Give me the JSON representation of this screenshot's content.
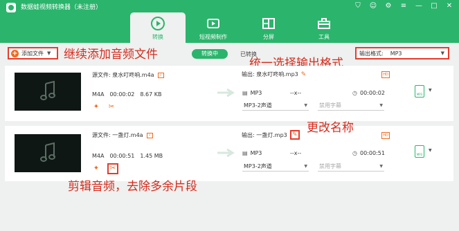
{
  "app": {
    "title": "数据蛙视频转换器（未注册）",
    "window_controls": [
      "cart-icon",
      "user-icon",
      "settings-icon",
      "menu-icon",
      "minimize-icon",
      "maximize-icon",
      "close-icon"
    ]
  },
  "tabs": [
    {
      "label": "转换",
      "icon": "convert-icon",
      "active": true
    },
    {
      "label": "短视频制作",
      "icon": "video-make-icon",
      "active": false
    },
    {
      "label": "分屏",
      "icon": "split-screen-icon",
      "active": false
    },
    {
      "label": "工具",
      "icon": "toolbox-icon",
      "active": false
    }
  ],
  "toolbar": {
    "add_file": "添加文件",
    "segment_active": "转换中",
    "segment_done": "已转换",
    "output_format_label": "输出格式:",
    "output_format_value": "MP3"
  },
  "annotations": {
    "add": "继续添加音频文件",
    "format": "统一选择输出格式",
    "rename": "更改名称",
    "trim": "剪辑音频，去除多余片段"
  },
  "files": [
    {
      "source": "源文件: 泉水叮咚响.m4a",
      "format": "M4A",
      "duration": "00:00:02",
      "size": "8.67 KB",
      "output": "输出: 泉水叮咚响.mp3",
      "out_format": "MP3",
      "out_res": "--x--",
      "out_duration": "00:00:02",
      "audio_track": "MP3-2声道",
      "subtitle": "禁用字幕"
    },
    {
      "source": "源文件: 一盏灯.m4a",
      "format": "M4A",
      "duration": "00:00:51",
      "size": "1.45 MB",
      "output": "输出: 一盏灯.mp3",
      "out_format": "MP3",
      "out_res": "--x--",
      "out_duration": "00:00:51",
      "audio_track": "MP3-2声道",
      "subtitle": "禁用字幕"
    }
  ],
  "colors": {
    "brand": "#2bb46c",
    "accent": "#f06a1d",
    "annotation": "#d62b1e"
  }
}
